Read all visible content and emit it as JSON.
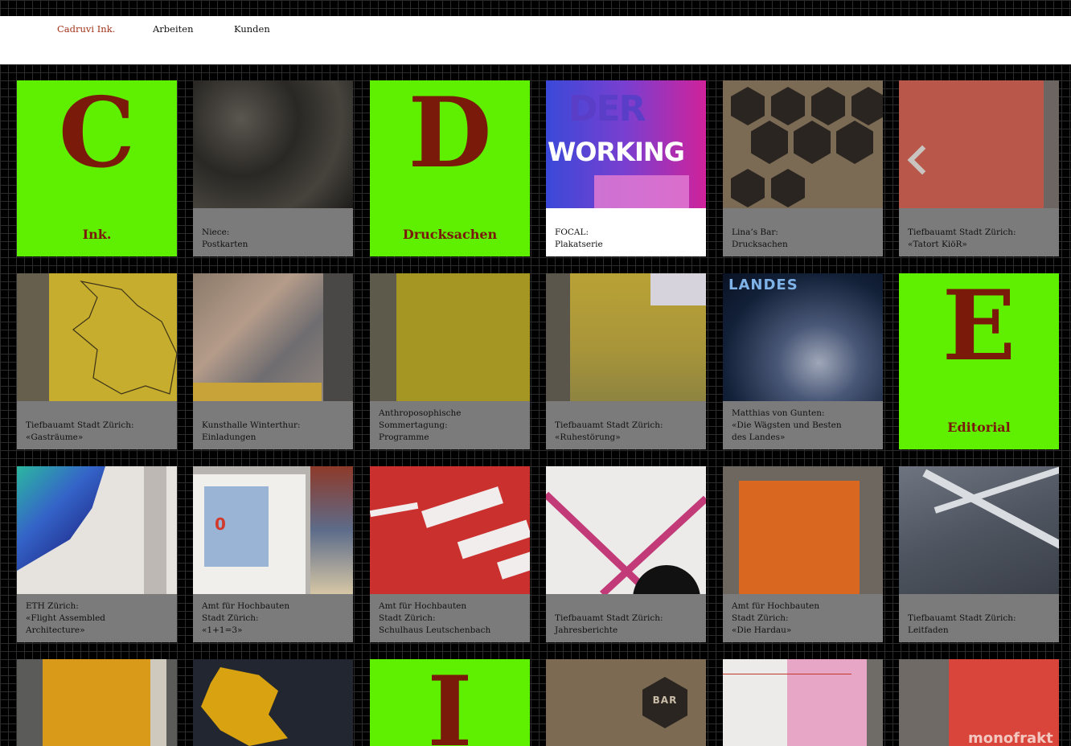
{
  "nav": {
    "items": [
      {
        "label": "Cadruvi Ink.",
        "active": true
      },
      {
        "label": "Arbeiten",
        "active": false
      },
      {
        "label": "Kunden",
        "active": false
      }
    ]
  },
  "tiles": {
    "ink": {
      "letter": "C",
      "word": "Ink."
    },
    "niece": {
      "line1": "Niece:",
      "line2": "Postkarten"
    },
    "drucksachen": {
      "letter": "D",
      "word": "Drucksachen"
    },
    "focal": {
      "line1": "FOCAL:",
      "line2": "Plakatserie",
      "art_top": "DER",
      "art_main": "WORKING"
    },
    "linas_bar": {
      "line1": "Lina’s Bar:",
      "line2": "Drucksachen"
    },
    "tatort": {
      "line1": "Tiefbauamt Stadt Zürich:",
      "line2": "«Tatort KiöR»"
    },
    "gastraeume": {
      "line1": "Tiefbauamt Stadt Zürich:",
      "line2": "«Gasträume»"
    },
    "kunsthalle": {
      "line1": "Kunsthalle Winterthur:",
      "line2": "Einladungen"
    },
    "anthro": {
      "line1": "Anthroposophische",
      "line2": "Sommertagung:",
      "line3": "Programme"
    },
    "ruhe": {
      "line1": "Tiefbauamt Stadt Zürich:",
      "line2": "«Ruhestörung»"
    },
    "landes": {
      "line1": "Matthias von Gunten:",
      "line2": "«Die Wägsten und Besten",
      "line3": "des Landes»",
      "art_title": "LANDES"
    },
    "editorial": {
      "letter": "E",
      "word": "Editorial"
    },
    "eth": {
      "line1": "ETH Zürich:",
      "line2": "«Flight Assembled",
      "line3": "Architecture»"
    },
    "amt_123": {
      "line1": "Amt für Hochbauten",
      "line2": "Stadt Zürich:",
      "line3": "«1+1=3»",
      "art_num": "0"
    },
    "amt_leutschenbach": {
      "line1": "Amt für Hochbauten",
      "line2": "Stadt Zürich:",
      "line3": "Schulhaus Leutschenbach"
    },
    "jahresberichte": {
      "line1": "Tiefbauamt Stadt Zürich:",
      "line2": "Jahresberichte"
    },
    "hardau": {
      "line1": "Amt für Hochbauten",
      "line2": "Stadt Zürich:",
      "line3": "«Die Hardau»"
    },
    "leitfaden": {
      "line1": "Tiefbauamt Stadt Zürich:",
      "line2": "Leitfaden"
    },
    "row4_i": {
      "letter": "I"
    },
    "bar_art": {
      "text": "BAR"
    },
    "monofrak_art": {
      "text": "monofrakt"
    }
  },
  "colors": {
    "accent_green": "#5ef000",
    "letter_brown": "#7a1a0a",
    "nav_active": "#a2341a",
    "caption_grey": "#7b7b7b"
  }
}
